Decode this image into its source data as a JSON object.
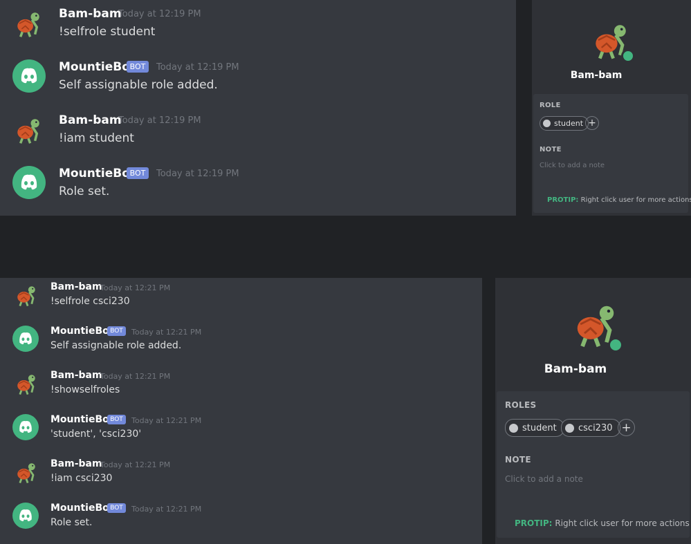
{
  "colors": {
    "online": "#43b581",
    "bot_badge": "#7289da",
    "background": "#36393f"
  },
  "top": {
    "messages": [
      {
        "author": "Bam-bam",
        "avatar": "turtle-avatar",
        "timestamp": "Today at 12:19 PM",
        "text": "!selfrole student"
      },
      {
        "author": "MountieBot",
        "avatar": "discord-avatar",
        "badge": "BOT",
        "timestamp": "Today at 12:19 PM",
        "text": "Self assignable role added."
      },
      {
        "author": "Bam-bam",
        "avatar": "turtle-avatar",
        "timestamp": "Today at 12:19 PM",
        "text": "!iam student"
      },
      {
        "author": "MountieBot",
        "avatar": "discord-avatar",
        "badge": "BOT",
        "timestamp": "Today at 12:19 PM",
        "text": "Role set."
      }
    ],
    "profile": {
      "name": "Bam-bam",
      "roles_label": "ROLE",
      "roles": [
        "student"
      ],
      "add_role": "+",
      "note_label": "NOTE",
      "note_placeholder": "Click to add a note",
      "protip_label": "PROTIP:",
      "protip_text": "Right click user for more actions"
    }
  },
  "bottom": {
    "messages": [
      {
        "author": "Bam-bam",
        "avatar": "turtle-avatar",
        "timestamp": "Today at 12:21 PM",
        "text": "!selfrole csci230"
      },
      {
        "author": "MountieBot",
        "avatar": "discord-avatar",
        "badge": "BOT",
        "timestamp": "Today at 12:21 PM",
        "text": "Self assignable role added."
      },
      {
        "author": "Bam-bam",
        "avatar": "turtle-avatar",
        "timestamp": "Today at 12:21 PM",
        "text": "!showselfroles"
      },
      {
        "author": "MountieBot",
        "avatar": "discord-avatar",
        "badge": "BOT",
        "timestamp": "Today at 12:21 PM",
        "text": "'student', 'csci230'"
      },
      {
        "author": "Bam-bam",
        "avatar": "turtle-avatar",
        "timestamp": "Today at 12:21 PM",
        "text": "!iam csci230"
      },
      {
        "author": "MountieBot",
        "avatar": "discord-avatar",
        "badge": "BOT",
        "timestamp": "Today at 12:21 PM",
        "text": "Role set."
      }
    ],
    "profile": {
      "name": "Bam-bam",
      "roles_label": "ROLES",
      "roles": [
        "student",
        "csci230"
      ],
      "add_role": "+",
      "note_label": "NOTE",
      "note_placeholder": "Click to add a note",
      "protip_label": "PROTIP:",
      "protip_text": "Right click user for more actions"
    }
  }
}
